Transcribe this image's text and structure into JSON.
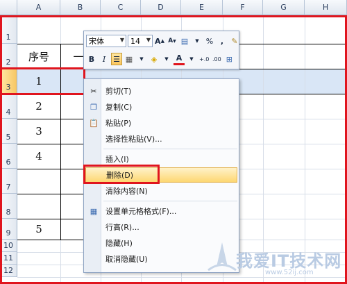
{
  "columns": [
    "A",
    "B",
    "C",
    "D",
    "E",
    "F",
    "G",
    "H"
  ],
  "rows": [
    "1",
    "2",
    "3",
    "4",
    "5",
    "6",
    "7",
    "8",
    "9",
    "10",
    "11",
    "12"
  ],
  "cells": {
    "header": "序号",
    "b2_partial": "一",
    "row3": "1",
    "row4": "2",
    "row5": "3",
    "row6": "4",
    "row9": "5"
  },
  "mini_toolbar": {
    "font_name": "宋体",
    "font_size": "14",
    "grow_font": "A",
    "shrink_font": "A",
    "percent": "%",
    "comma": ",",
    "bold": "B",
    "italic": "I",
    "font_color": "A",
    "inc_decimal": "+.0",
    "dec_decimal": ".00"
  },
  "context_menu": {
    "items": [
      {
        "label": "剪切(T)",
        "icon": "scissors-icon"
      },
      {
        "label": "复制(C)",
        "icon": "copy-icon"
      },
      {
        "label": "粘贴(P)",
        "icon": "paste-icon"
      },
      {
        "label": "选择性粘贴(V)..."
      },
      {
        "label": "插入(I)"
      },
      {
        "label": "删除(D)",
        "highlighted": true
      },
      {
        "label": "清除内容(N)"
      },
      {
        "label": "设置单元格格式(F)...",
        "icon": "format-cells-icon"
      },
      {
        "label": "行高(R)..."
      },
      {
        "label": "隐藏(H)"
      },
      {
        "label": "取消隐藏(U)"
      }
    ]
  },
  "watermark": {
    "brand": "我爱IT技术网",
    "url": "www.52ij.com"
  },
  "colors": {
    "highlight_red": "#e0151e",
    "menu_highlight": "#fdd772",
    "header_blue": "#dfe6ef"
  }
}
